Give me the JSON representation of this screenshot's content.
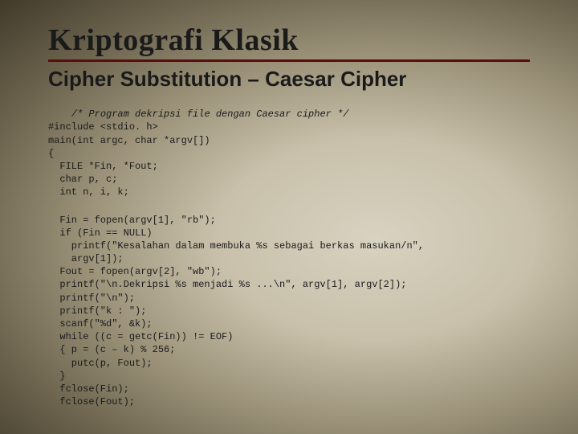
{
  "title": "Kriptografi Klasik",
  "subtitle": "Cipher Substitution – Caesar Cipher",
  "code_comment": "/* Program dekripsi file dengan Caesar cipher */",
  "code_block1": "#include <stdio. h>\nmain(int argc, char *argv[])\n{\n  FILE *Fin, *Fout;\n  char p, c;\n  int n, i, k;",
  "code_block2": "  Fin = fopen(argv[1], \"rb\");\n  if (Fin == NULL)\n    printf(\"Kesalahan dalam membuka %s sebagai berkas masukan/n\",\n    argv[1]);\n  Fout = fopen(argv[2], \"wb\");\n  printf(\"\\n.Dekripsi %s menjadi %s ...\\n\", argv[1], argv[2]);\n  printf(\"\\n\");\n  printf(\"k : \");\n  scanf(\"%d\", &k);\n  while ((c = getc(Fin)) != EOF)\n  { p = (c – k) % 256;\n    putc(p, Fout);\n  }\n  fclose(Fin);\n  fclose(Fout);"
}
